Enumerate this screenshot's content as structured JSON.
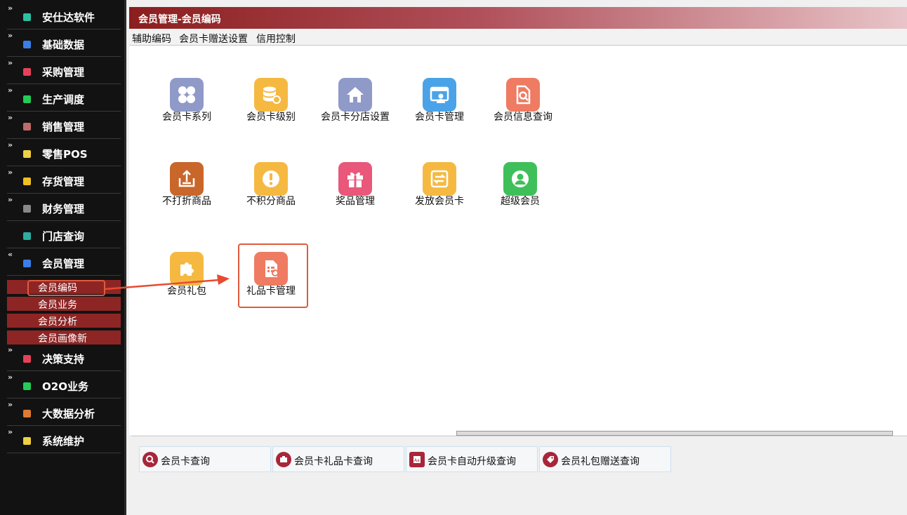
{
  "sidebar": {
    "items": [
      {
        "label": "安仕达软件",
        "color": "#2bc0a0",
        "chevron": "»"
      },
      {
        "label": "基础数据",
        "color": "#3a7ee8",
        "chevron": "»"
      },
      {
        "label": "采购管理",
        "color": "#e8405a",
        "chevron": "»"
      },
      {
        "label": "生产调度",
        "color": "#22cc55",
        "chevron": "»"
      },
      {
        "label": "销售管理",
        "color": "#c06a6a",
        "chevron": "»"
      },
      {
        "label": "零售POS",
        "color": "#f0d040",
        "chevron": "»"
      },
      {
        "label": "存货管理",
        "color": "#f0c020",
        "chevron": "»"
      },
      {
        "label": "财务管理",
        "color": "#888888",
        "chevron": "»"
      },
      {
        "label": "门店查询",
        "color": "#2bb0a0",
        "chevron": ""
      },
      {
        "label": "会员管理",
        "color": "#3a7ee8",
        "chevron": "»"
      }
    ],
    "member_sub": [
      {
        "label": "会员编码"
      },
      {
        "label": "会员业务"
      },
      {
        "label": "会员分析"
      },
      {
        "label": "会员画像新"
      }
    ],
    "items_after": [
      {
        "label": "决策支持",
        "color": "#e8405a",
        "chevron": "»"
      },
      {
        "label": "O2O业务",
        "color": "#22cc55",
        "chevron": "»"
      },
      {
        "label": "大数据分析",
        "color": "#e07a30",
        "chevron": "»"
      },
      {
        "label": "系统维护",
        "color": "#f0d040",
        "chevron": "»"
      }
    ]
  },
  "header": {
    "title": "会员管理-会员编码"
  },
  "menu": {
    "items": [
      "辅助编码",
      "会员卡赠送设置",
      "信用控制"
    ]
  },
  "tiles": [
    {
      "label": "会员卡系列",
      "icon": "grid-icon",
      "color": "#8f9ac9"
    },
    {
      "label": "会员卡级别",
      "icon": "database-icon",
      "color": "#f5b942"
    },
    {
      "label": "会员卡分店设置",
      "icon": "home-icon",
      "color": "#8f9ac9"
    },
    {
      "label": "会员卡管理",
      "icon": "card-users-icon",
      "color": "#4aa3e8"
    },
    {
      "label": "会员信息查询",
      "icon": "doc-search-icon",
      "color": "#ef7b62"
    },
    {
      "label": "不打折商品",
      "icon": "upload-icon",
      "color": "#c9662a"
    },
    {
      "label": "不积分商品",
      "icon": "exclamation-icon",
      "color": "#f5b942"
    },
    {
      "label": "奖品管理",
      "icon": "gift-icon",
      "color": "#e9577a"
    },
    {
      "label": "发放会员卡",
      "icon": "exchange-icon",
      "color": "#f5b942"
    },
    {
      "label": "超级会员",
      "icon": "user-circle-icon",
      "color": "#3fbf5a"
    },
    {
      "label": "会员礼包",
      "icon": "puzzle-icon",
      "color": "#f5b942"
    },
    {
      "label": "礼品卡管理",
      "icon": "gift-card-doc-icon",
      "color": "#ef7b62"
    }
  ],
  "quick": [
    {
      "label": "会员卡查询",
      "icon": "search-icon"
    },
    {
      "label": "会员卡礼品卡查询",
      "icon": "gift-card-icon"
    },
    {
      "label": "会员卡自动升级查询",
      "icon": "upgrade-icon"
    },
    {
      "label": "会员礼包赠送查询",
      "icon": "tag-icon"
    }
  ]
}
